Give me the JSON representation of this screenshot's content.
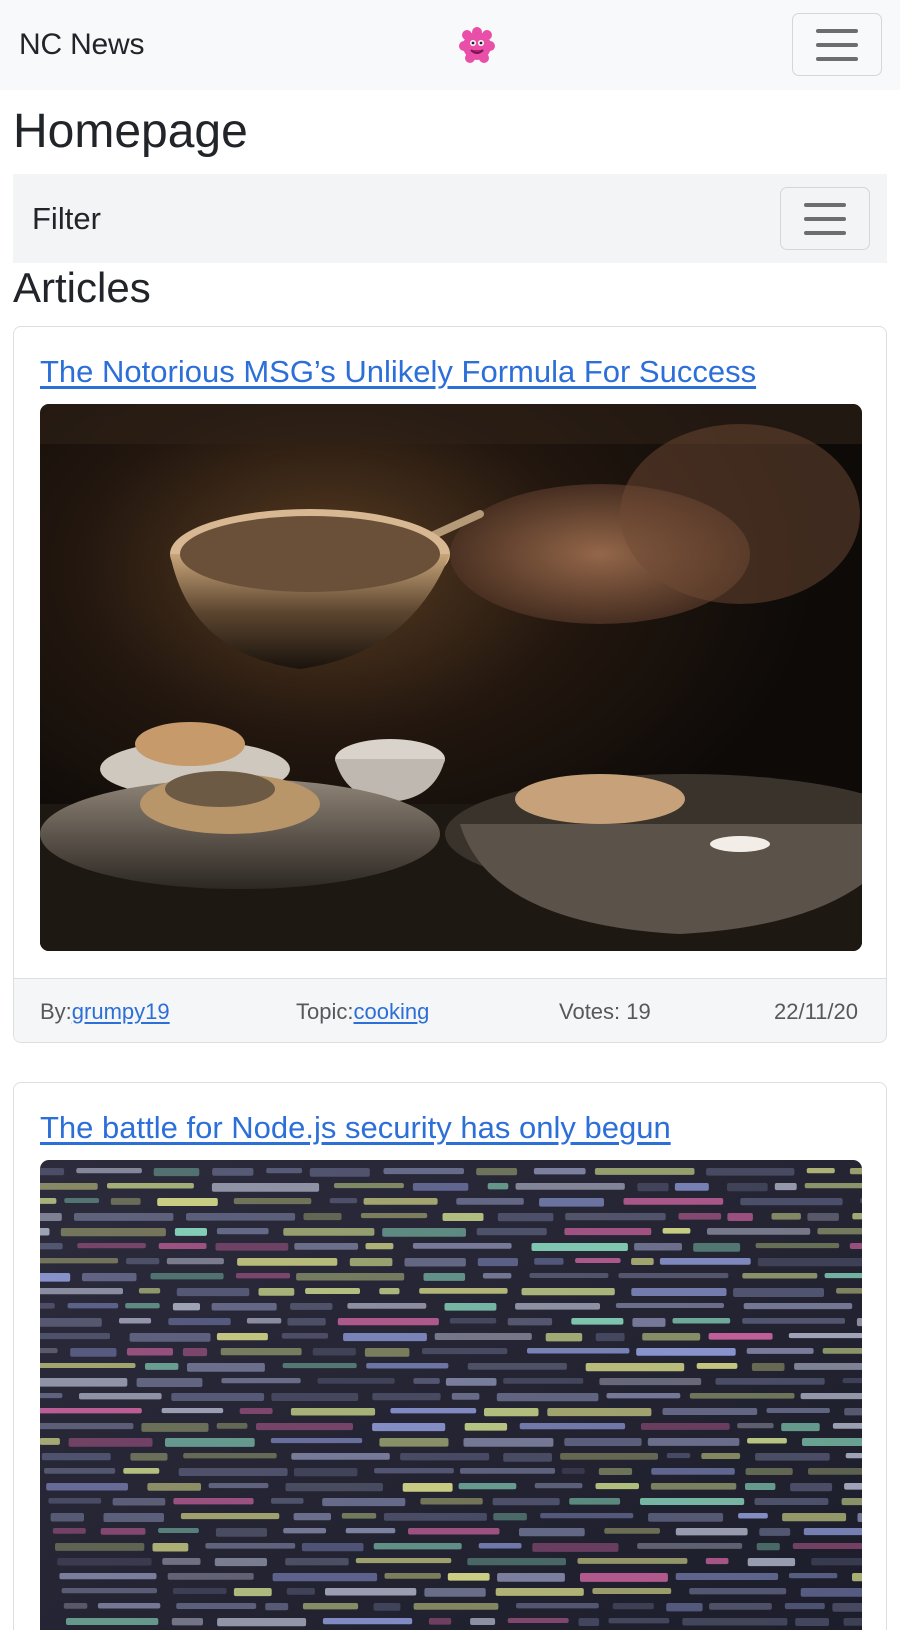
{
  "navbar": {
    "brand": "NC News",
    "logo_icon": "pink-monster-logo-icon",
    "menu_icon": "hamburger-menu-icon"
  },
  "page": {
    "title": "Homepage"
  },
  "filter": {
    "label": "Filter",
    "menu_icon": "hamburger-menu-icon"
  },
  "articles": {
    "heading": "Articles",
    "items": [
      {
        "title": "The Notorious MSG’s Unlikely Formula For Success",
        "image": "kitchen-cooking-photo",
        "author_label": "By:",
        "author": "grumpy19",
        "topic_label": "Topic:",
        "topic": "cooking",
        "votes": "Votes: 19",
        "date": "22/11/20"
      },
      {
        "title": "The battle for Node.js security has only begun",
        "image": "code-screen-photo"
      }
    ]
  },
  "colors": {
    "navbar_bg": "#f8f9fa",
    "link": "#2d6fd8",
    "text": "#212529",
    "logo_pink": "#e94fa8"
  }
}
